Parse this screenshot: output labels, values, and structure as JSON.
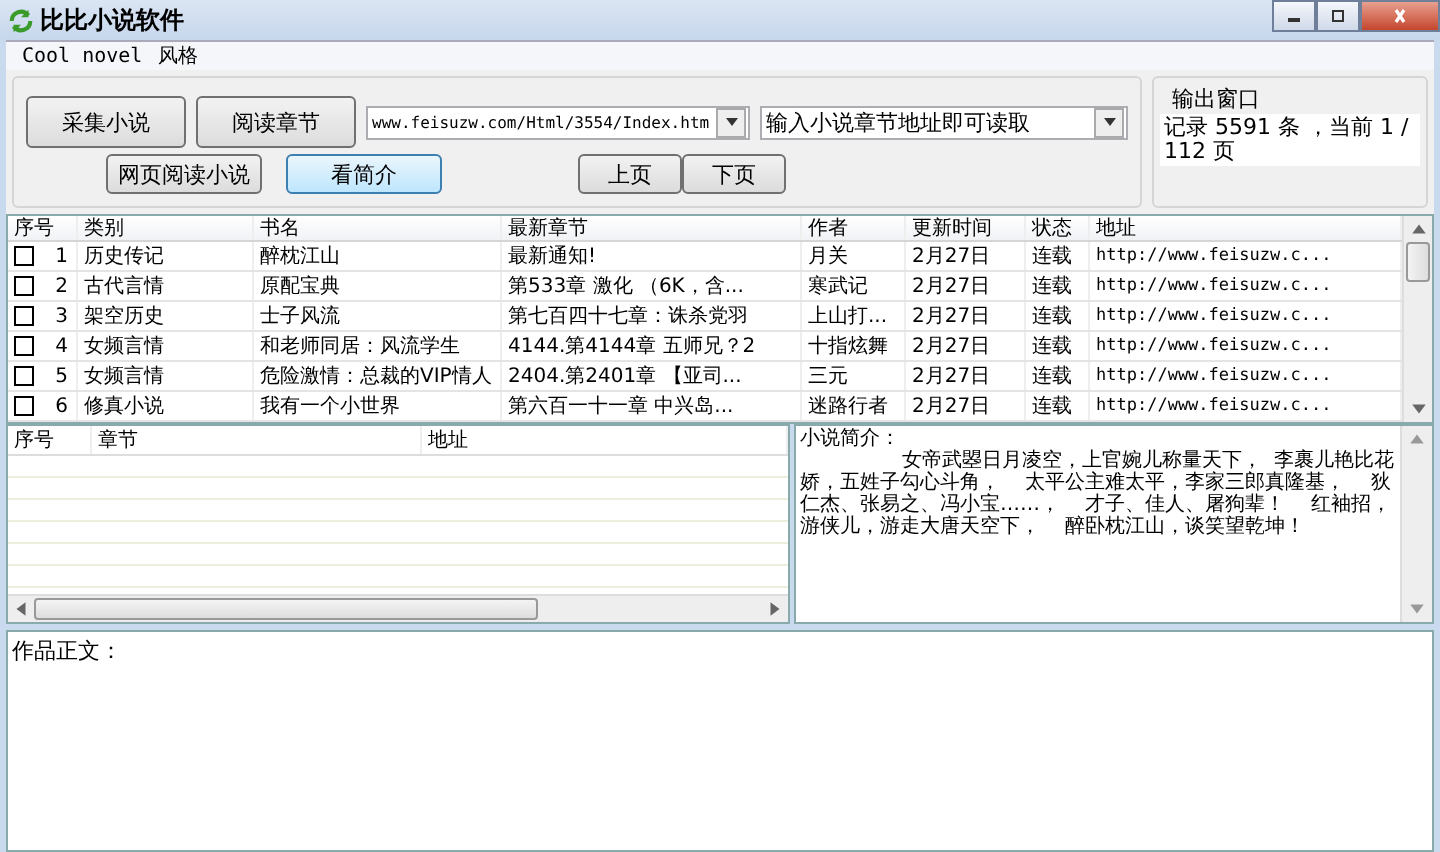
{
  "window": {
    "title": "比比小说软件"
  },
  "menu": [
    "Cool novel",
    "风格"
  ],
  "buttons": [
    {
      "label": "采集小说",
      "focused": false
    },
    {
      "label": "阅读章节",
      "focused": false
    },
    {
      "label": "网页阅读小说",
      "focused": false
    },
    {
      "label": "看简介",
      "focused": true
    },
    {
      "label": "上页",
      "focused": false
    },
    {
      "label": "下页",
      "focused": false
    }
  ],
  "url_combo": {
    "value": "www.feisuzw.com/Html/3554/Index.htm"
  },
  "chapter_combo": {
    "value": "输入小说章节地址即可读取"
  },
  "output": {
    "title": "输出窗口",
    "text": "记录 5591 条 ，当前 1 / 112 页"
  },
  "novels": {
    "columns": [
      "序号",
      "类别",
      "书名",
      "最新章节",
      "作者",
      "更新时间",
      "状态",
      "地址"
    ],
    "rows": [
      {
        "checked": false,
        "cells": [
          "1",
          "历史传记",
          "醉枕江山",
          "最新通知!",
          "月关",
          "2月27日",
          "连载",
          "http://www.feisuzw.c..."
        ]
      },
      {
        "checked": false,
        "cells": [
          "2",
          "古代言情",
          "原配宝典",
          "第533章 激化 （6K，含...",
          "寒武记",
          "2月27日",
          "连载",
          "http://www.feisuzw.c..."
        ]
      },
      {
        "checked": false,
        "cells": [
          "3",
          "架空历史",
          "士子风流",
          "第七百四十七章：诛杀党羽",
          "上山打...",
          "2月27日",
          "连载",
          "http://www.feisuzw.c..."
        ]
      },
      {
        "checked": false,
        "cells": [
          "4",
          "女频言情",
          "和老师同居：风流学生",
          "4144.第4144章 五师兄？2",
          "十指炫舞",
          "2月27日",
          "连载",
          "http://www.feisuzw.c..."
        ]
      },
      {
        "checked": false,
        "cells": [
          "5",
          "女频言情",
          "危险激情：总裁的VIP情人",
          "2404.第2401章 【亚司...",
          "三元",
          "2月27日",
          "连载",
          "http://www.feisuzw.c..."
        ]
      },
      {
        "checked": false,
        "cells": [
          "6",
          "修真小说",
          "我有一个小世界",
          "第六百一十一章 中兴岛...",
          "迷路行者",
          "2月27日",
          "连载",
          "http://www.feisuzw.c..."
        ]
      }
    ]
  },
  "chapters": {
    "columns": [
      "序号",
      "章节",
      "地址"
    ]
  },
  "intro": {
    "label": "小说简介：",
    "text": "                女帝武曌日月凌空，上官婉儿称量天下，  李裹儿艳比花娇，五姓子勾心斗角，    太平公主难太平，李家三郎真隆基，    狄仁杰、张易之、冯小宝……，    才子、佳人、屠狗辈！    红袖招，游侠儿，游走大唐天空下，    醉卧枕江山，谈笑望乾坤！"
  },
  "body": {
    "label": "作品正文："
  }
}
